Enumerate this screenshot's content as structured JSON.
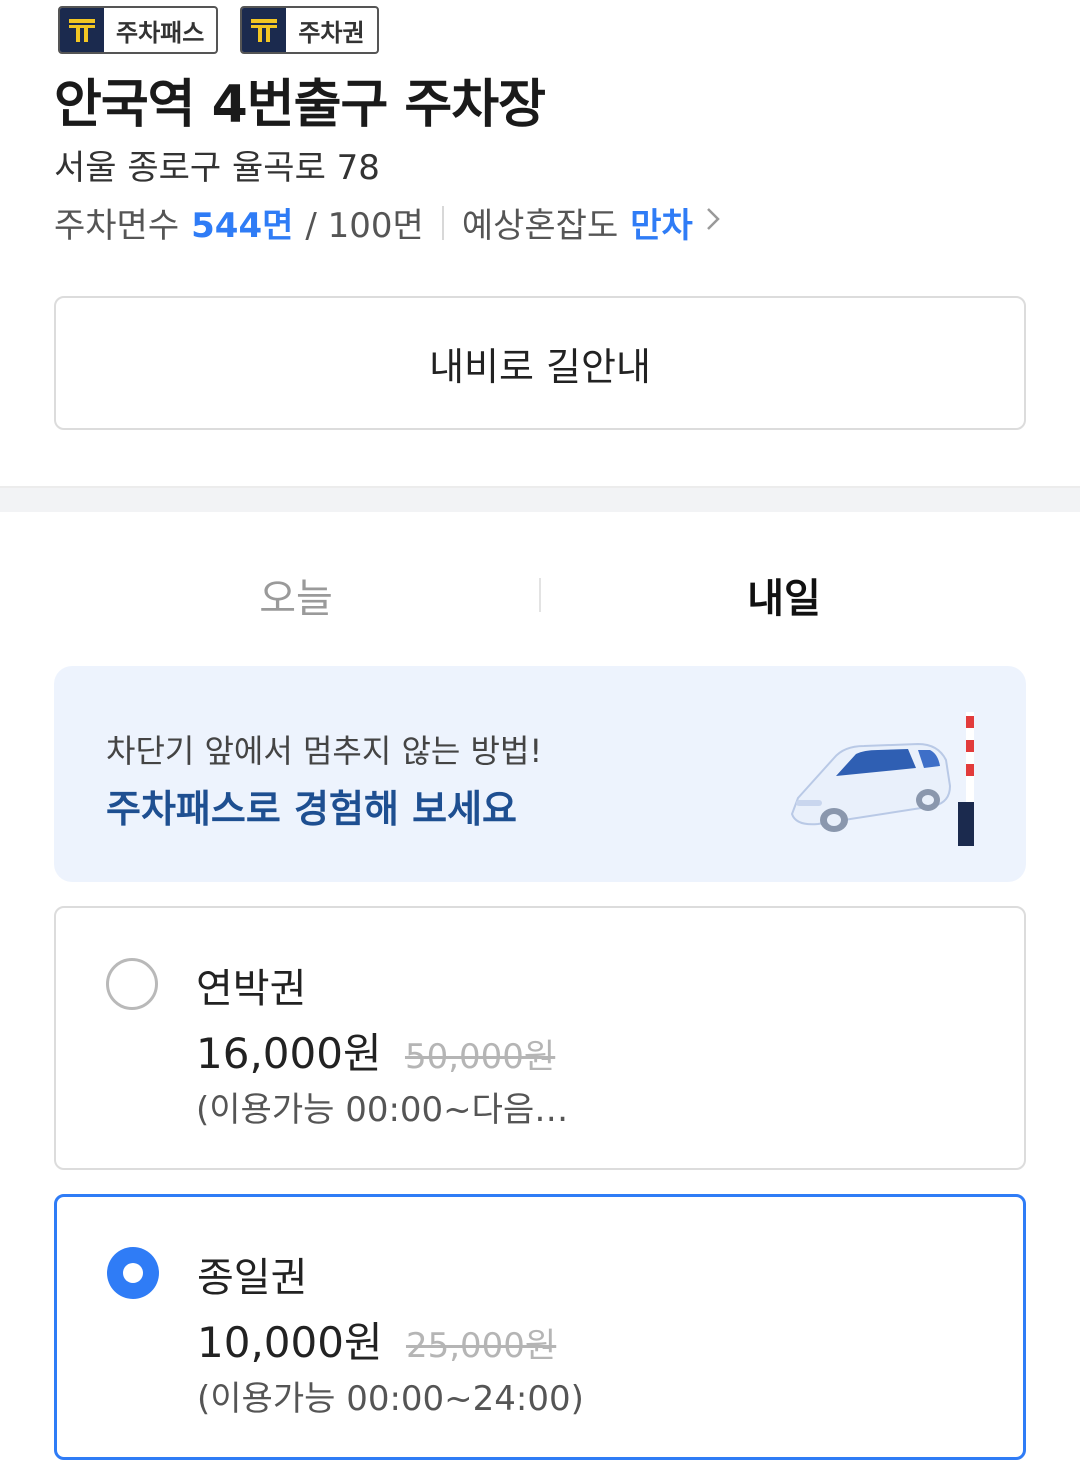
{
  "badges": [
    "주차패스",
    "주차권"
  ],
  "colors": {
    "accent": "#2f7cf6",
    "promo_bg": "#edf3fd",
    "promo_title": "#1e4f91",
    "badge_logo": "#1b2a4e"
  },
  "parking": {
    "name": "안국역 4번출구 주차장",
    "address": "서울 종로구 율곡로 78",
    "spaces_label": "주차면수",
    "spaces_value": "544면",
    "spaces_total": "/ 100면",
    "congestion_label": "예상혼잡도",
    "congestion_value": "만차"
  },
  "nav_button": "내비로 길안내",
  "tabs": [
    {
      "label": "오늘",
      "active": false
    },
    {
      "label": "내일",
      "active": true
    }
  ],
  "promo": {
    "line1": "차단기 앞에서 멈추지 않는 방법!",
    "line2": "주차패스로 경험해 보세요"
  },
  "tickets": [
    {
      "name": "연박권",
      "price": "16,000원",
      "original": "50,000원",
      "availability": "(이용가능 00:00~다음…",
      "selected": false
    },
    {
      "name": "종일권",
      "price": "10,000원",
      "original": "25,000원",
      "availability": "(이용가능 00:00~24:00)",
      "selected": true
    }
  ]
}
